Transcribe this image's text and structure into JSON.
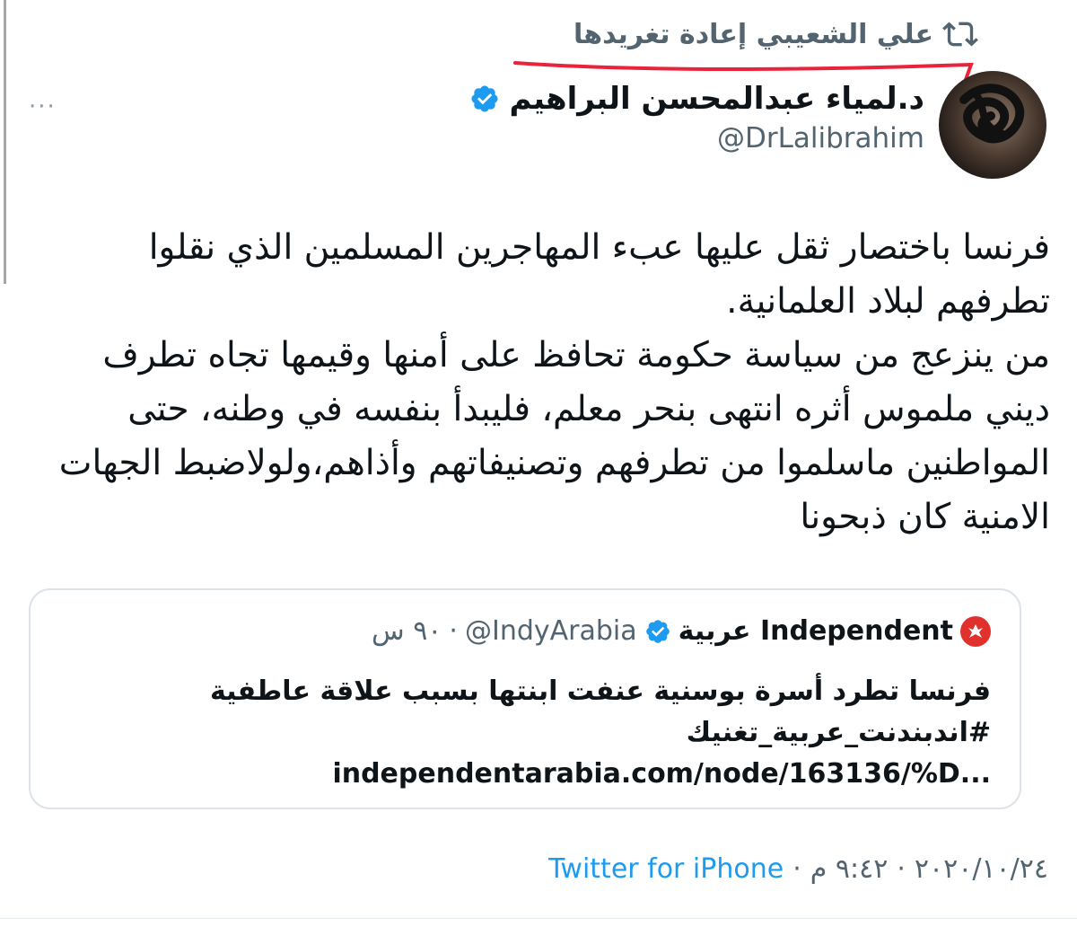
{
  "retweet": {
    "label": "علي الشعيبي إعادة تغريدها"
  },
  "author": {
    "name": "د.لمياء عبدالمحسن البراهيم",
    "handle": "@DrLalibrahim"
  },
  "tweet": {
    "text": "فرنسا باختصار ثقل عليها عبء المهاجرين المسلمين الذي نقلوا تطرفهم لبلاد العلمانية.\nمن ينزعج من سياسة حكومة تحافظ على أمنها وقيمها تجاه تطرف ديني ملموس أثره انتهى بنحر معلم، فليبدأ بنفسه في وطنه، حتى المواطنين ماسلموا من تطرفهم وتصنيفاتهم وأذاهم،ولولاضبط الجهات الامنية كان ذبحونا"
  },
  "quote": {
    "name": "Independent عربية",
    "handle": "@IndyArabia",
    "separator": "·",
    "time": "٩٠ س",
    "line1": "فرنسا تطرد أسرة بوسنية عنفت ابنتها بسبب علاقة عاطفية",
    "line2": "#اندبندنت_عربية_تغنيك",
    "link": "independentarabia.com/node/163136/%D..."
  },
  "footer": {
    "date": "٢٠٢٠/١٠/٢٤",
    "time": "٩:٤٢ م",
    "separator": "·",
    "source": "Twitter for iPhone"
  },
  "colors": {
    "accent": "#1d9bf0",
    "annotation": "#e8233a",
    "muted": "#536471"
  },
  "icons": {
    "retweet": "retweet-icon",
    "verified": "verified-badge-icon",
    "more": "more-options-icon"
  }
}
